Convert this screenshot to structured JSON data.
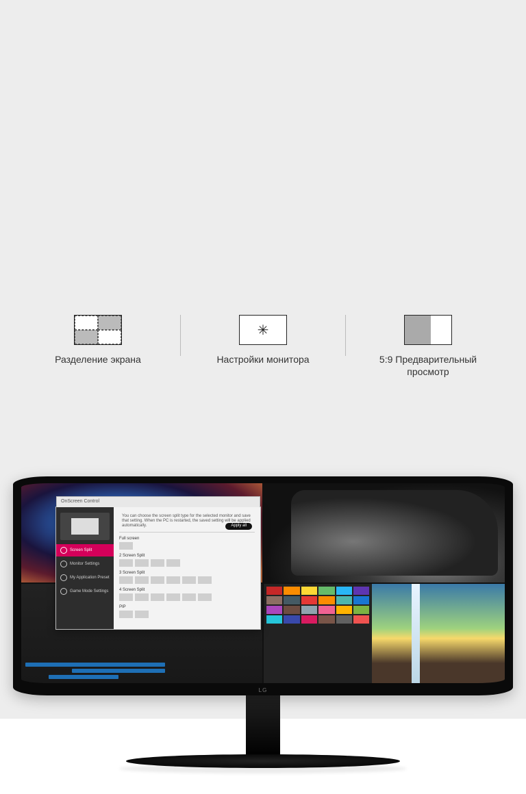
{
  "features": {
    "screen_split": {
      "label": "Разделение экрана"
    },
    "monitor_settings": {
      "label": "Настройки монитора"
    },
    "preview_5_9": {
      "label": "5:9 Предварительный просмотр"
    }
  },
  "osc_dialog": {
    "title": "OnScreen Control",
    "description": "You can choose the screen split type for the selected monitor and save that setting. When the PC is restarted, the saved setting will be applied automatically.",
    "apply_label": "Apply all",
    "nav": {
      "screen_split": "Screen Split",
      "monitor_settings": "Monitor Settings",
      "my_app_preset": "My Application Preset",
      "game_mode": "Game Mode Settings"
    },
    "sections": {
      "full": "Full screen",
      "two": "2 Screen Split",
      "three": "3 Screen Split",
      "four": "4 Screen Split",
      "pip": "PIP"
    }
  },
  "monitor": {
    "brand": "LG"
  },
  "thumb_colors": [
    "#c62828",
    "#fb8c00",
    "#fdd835",
    "#66bb6a",
    "#29b6f6",
    "#5e35b1",
    "#8d6e63",
    "#455a64",
    "#e53935",
    "#fb8c00",
    "#4db6ac",
    "#1976d2",
    "#ab47bc",
    "#6d4c41",
    "#90a4ae",
    "#f06292",
    "#ffb300",
    "#7cb342",
    "#26c6da",
    "#3949ab",
    "#d81b60",
    "#795548",
    "#616161",
    "#ef5350"
  ]
}
